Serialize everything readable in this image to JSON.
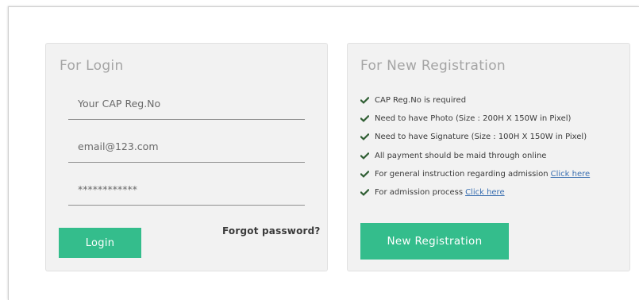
{
  "login": {
    "title": "For Login",
    "reg_no_placeholder": "Your CAP Reg.No",
    "email_placeholder": "email@123.com",
    "password_placeholder": "************",
    "login_label": "Login",
    "forgot_label": "Forgot password?"
  },
  "registration": {
    "title": "For New Registration",
    "items": [
      {
        "text": "CAP Reg.No is required",
        "link": ""
      },
      {
        "text": "Need to have Photo (Size : 200H X 150W in Pixel)",
        "link": ""
      },
      {
        "text": "Need to have Signature (Size : 100H X 150W in Pixel)",
        "link": ""
      },
      {
        "text": "All payment should be maid through online",
        "link": ""
      },
      {
        "text": "For general instruction regarding admission",
        "link": "Click here"
      },
      {
        "text": "For admission process",
        "link": "Click here"
      }
    ],
    "button_label": "New Registration"
  },
  "colors": {
    "accent_green": "#34bd8c",
    "check_green": "#2f5e33",
    "link_blue": "#3a6fb0",
    "panel_bg": "#f2f2f2"
  },
  "icons": {
    "check": "check-icon"
  }
}
